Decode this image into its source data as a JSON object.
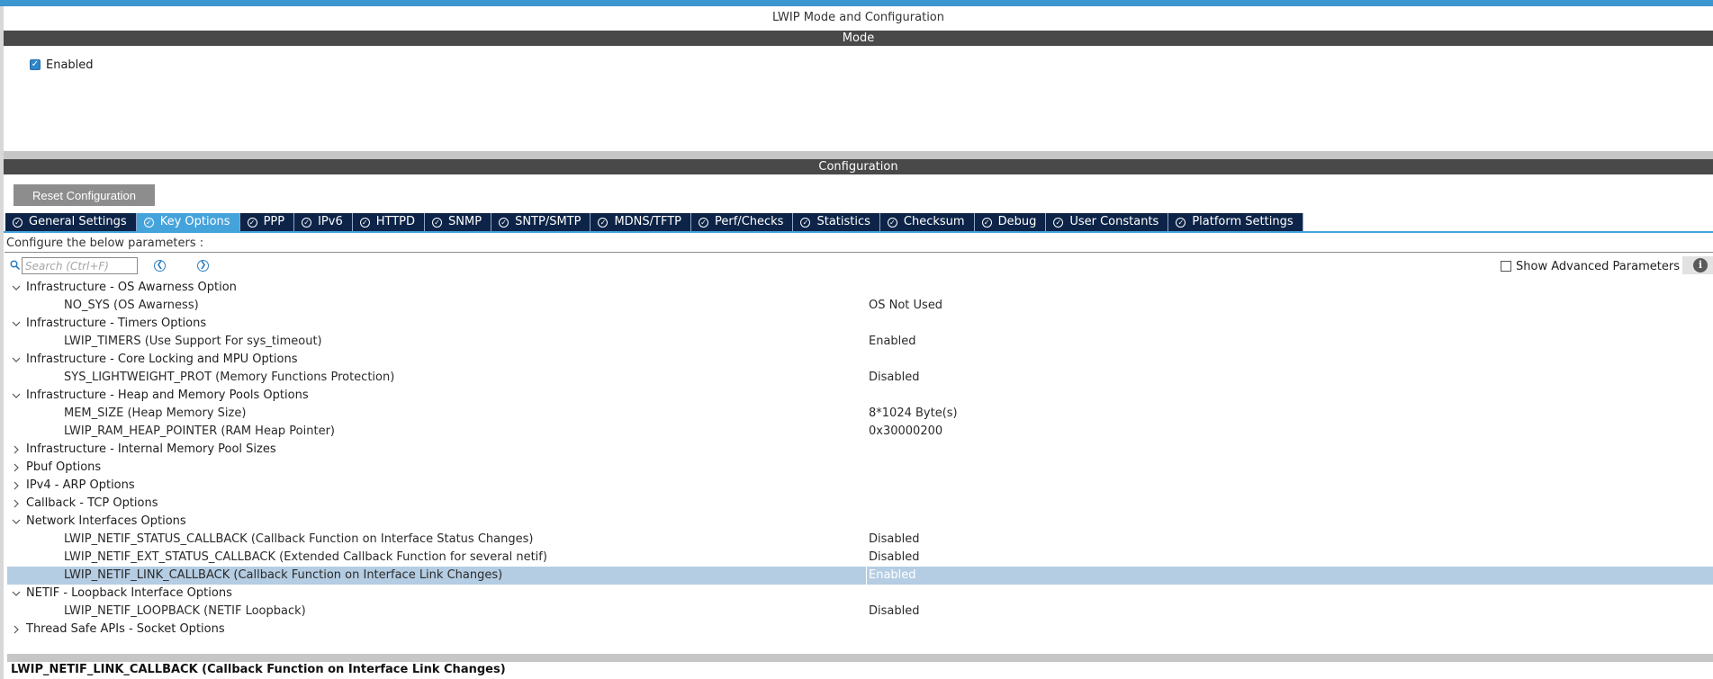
{
  "title": "LWIP Mode and Configuration",
  "mode": {
    "header": "Mode",
    "enabled_label": "Enabled",
    "enabled_checked": true
  },
  "config": {
    "header": "Configuration",
    "reset_label": "Reset Configuration",
    "tabs": [
      {
        "label": "General Settings",
        "active": false
      },
      {
        "label": "Key Options",
        "active": true
      },
      {
        "label": "PPP",
        "active": false
      },
      {
        "label": "IPv6",
        "active": false
      },
      {
        "label": "HTTPD",
        "active": false
      },
      {
        "label": "SNMP",
        "active": false
      },
      {
        "label": "SNTP/SMTP",
        "active": false
      },
      {
        "label": "MDNS/TFTP",
        "active": false
      },
      {
        "label": "Perf/Checks",
        "active": false
      },
      {
        "label": "Statistics",
        "active": false
      },
      {
        "label": "Checksum",
        "active": false
      },
      {
        "label": "Debug",
        "active": false
      },
      {
        "label": "User Constants",
        "active": false
      },
      {
        "label": "Platform Settings",
        "active": false
      }
    ],
    "configure_text": "Configure the below parameters :",
    "search_placeholder": "Search (Ctrl+F)",
    "show_advanced_label": "Show Advanced Parameters",
    "tree": [
      {
        "type": "group",
        "expanded": true,
        "label": "Infrastructure - OS Awarness Option"
      },
      {
        "type": "param",
        "label": "NO_SYS (OS Awarness)",
        "value": "OS Not Used"
      },
      {
        "type": "group",
        "expanded": true,
        "label": "Infrastructure - Timers Options"
      },
      {
        "type": "param",
        "label": "LWIP_TIMERS (Use Support For sys_timeout)",
        "value": "Enabled"
      },
      {
        "type": "group",
        "expanded": true,
        "label": "Infrastructure - Core Locking and MPU Options"
      },
      {
        "type": "param",
        "label": "SYS_LIGHTWEIGHT_PROT (Memory Functions Protection)",
        "value": "Disabled"
      },
      {
        "type": "group",
        "expanded": true,
        "label": "Infrastructure - Heap and Memory Pools Options"
      },
      {
        "type": "param",
        "label": "MEM_SIZE (Heap Memory Size)",
        "value": "8*1024 Byte(s)"
      },
      {
        "type": "param",
        "label": "LWIP_RAM_HEAP_POINTER (RAM Heap Pointer)",
        "value": "0x30000200"
      },
      {
        "type": "group",
        "expanded": false,
        "label": "Infrastructure - Internal Memory Pool Sizes"
      },
      {
        "type": "group",
        "expanded": false,
        "label": "Pbuf Options"
      },
      {
        "type": "group",
        "expanded": false,
        "label": "IPv4 - ARP Options"
      },
      {
        "type": "group",
        "expanded": false,
        "label": "Callback - TCP Options"
      },
      {
        "type": "group",
        "expanded": true,
        "label": "Network Interfaces Options"
      },
      {
        "type": "param",
        "label": "LWIP_NETIF_STATUS_CALLBACK (Callback Function on Interface Status Changes)",
        "value": "Disabled"
      },
      {
        "type": "param",
        "label": "LWIP_NETIF_EXT_STATUS_CALLBACK (Extended Callback Function for several netif)",
        "value": "Disabled"
      },
      {
        "type": "param",
        "label": "LWIP_NETIF_LINK_CALLBACK (Callback Function on Interface Link Changes)",
        "value": "Enabled",
        "selected": true
      },
      {
        "type": "group",
        "expanded": true,
        "label": "NETIF - Loopback Interface Options"
      },
      {
        "type": "param",
        "label": "LWIP_NETIF_LOOPBACK (NETIF Loopback)",
        "value": "Disabled"
      },
      {
        "type": "group",
        "expanded": false,
        "label": "Thread Safe APIs - Socket Options"
      }
    ],
    "description_title": "LWIP_NETIF_LINK_CALLBACK (Callback Function on Interface Link Changes)"
  },
  "colors": {
    "accent": "#3c96cf",
    "tab_bg": "#0d2448",
    "tab_active": "#45a3dc",
    "section_bar": "#494949",
    "selection": "#b5cde3"
  }
}
